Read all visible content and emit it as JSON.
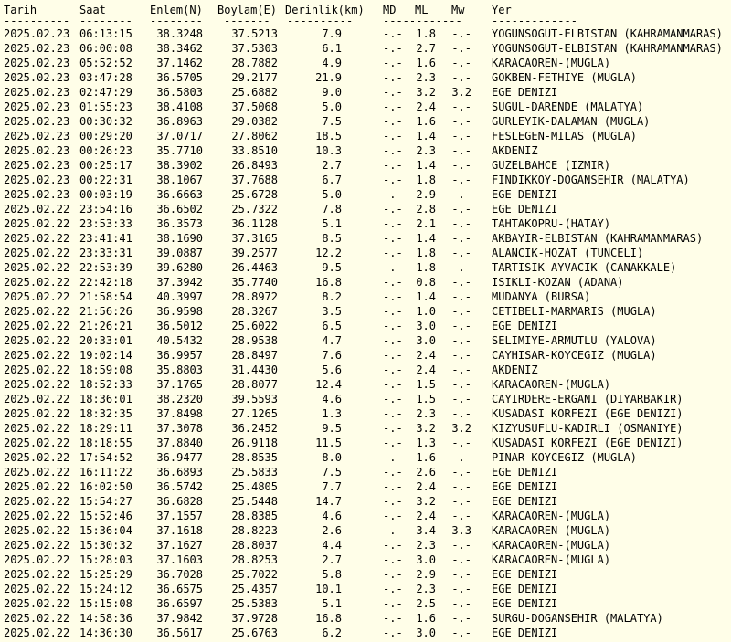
{
  "headers": {
    "date": "Tarih",
    "time": "Saat",
    "lat": "Enlem(N)",
    "lon": "Boylam(E)",
    "depth": "Derinlik(km)",
    "md": "MD",
    "ml": "ML",
    "mw": "Mw",
    "loc": "Yer"
  },
  "separators": {
    "date": "----------",
    "time": "--------",
    "lat": "--------",
    "lon": "-------",
    "depth": "----------",
    "md": "------------",
    "loc": "-------------"
  },
  "rows": [
    {
      "date": "2025.02.23",
      "time": "06:13:15",
      "lat": "38.3248",
      "lon": "37.5213",
      "depth": "7.9",
      "md": "-.-",
      "ml": "1.8",
      "mw": "-.-",
      "loc": "YOGUNSOGUT-ELBISTAN (KAHRAMANMARAS)"
    },
    {
      "date": "2025.02.23",
      "time": "06:00:08",
      "lat": "38.3462",
      "lon": "37.5303",
      "depth": "6.1",
      "md": "-.-",
      "ml": "2.7",
      "mw": "-.-",
      "loc": "YOGUNSOGUT-ELBISTAN (KAHRAMANMARAS)"
    },
    {
      "date": "2025.02.23",
      "time": "05:52:52",
      "lat": "37.1462",
      "lon": "28.7882",
      "depth": "4.9",
      "md": "-.-",
      "ml": "1.6",
      "mw": "-.-",
      "loc": "KARACAOREN-(MUGLA)"
    },
    {
      "date": "2025.02.23",
      "time": "03:47:28",
      "lat": "36.5705",
      "lon": "29.2177",
      "depth": "21.9",
      "md": "-.-",
      "ml": "2.3",
      "mw": "-.-",
      "loc": "GOKBEN-FETHIYE (MUGLA)"
    },
    {
      "date": "2025.02.23",
      "time": "02:47:29",
      "lat": "36.5803",
      "lon": "25.6882",
      "depth": "9.0",
      "md": "-.-",
      "ml": "3.2",
      "mw": "3.2",
      "loc": "EGE DENIZI"
    },
    {
      "date": "2025.02.23",
      "time": "01:55:23",
      "lat": "38.4108",
      "lon": "37.5068",
      "depth": "5.0",
      "md": "-.-",
      "ml": "2.4",
      "mw": "-.-",
      "loc": "SUGUL-DARENDE (MALATYA)"
    },
    {
      "date": "2025.02.23",
      "time": "00:30:32",
      "lat": "36.8963",
      "lon": "29.0382",
      "depth": "7.5",
      "md": "-.-",
      "ml": "1.6",
      "mw": "-.-",
      "loc": "GURLEYIK-DALAMAN (MUGLA)"
    },
    {
      "date": "2025.02.23",
      "time": "00:29:20",
      "lat": "37.0717",
      "lon": "27.8062",
      "depth": "18.5",
      "md": "-.-",
      "ml": "1.4",
      "mw": "-.-",
      "loc": "FESLEGEN-MILAS (MUGLA)"
    },
    {
      "date": "2025.02.23",
      "time": "00:26:23",
      "lat": "35.7710",
      "lon": "33.8510",
      "depth": "10.3",
      "md": "-.-",
      "ml": "2.3",
      "mw": "-.-",
      "loc": "AKDENIZ"
    },
    {
      "date": "2025.02.23",
      "time": "00:25:17",
      "lat": "38.3902",
      "lon": "26.8493",
      "depth": "2.7",
      "md": "-.-",
      "ml": "1.4",
      "mw": "-.-",
      "loc": "GUZELBAHCE (IZMIR)"
    },
    {
      "date": "2025.02.23",
      "time": "00:22:31",
      "lat": "38.1067",
      "lon": "37.7688",
      "depth": "6.7",
      "md": "-.-",
      "ml": "1.8",
      "mw": "-.-",
      "loc": "FINDIKKOY-DOGANSEHIR (MALATYA)"
    },
    {
      "date": "2025.02.23",
      "time": "00:03:19",
      "lat": "36.6663",
      "lon": "25.6728",
      "depth": "5.0",
      "md": "-.-",
      "ml": "2.9",
      "mw": "-.-",
      "loc": "EGE DENIZI"
    },
    {
      "date": "2025.02.22",
      "time": "23:54:16",
      "lat": "36.6502",
      "lon": "25.7322",
      "depth": "7.8",
      "md": "-.-",
      "ml": "2.8",
      "mw": "-.-",
      "loc": "EGE DENIZI"
    },
    {
      "date": "2025.02.22",
      "time": "23:53:33",
      "lat": "36.3573",
      "lon": "36.1128",
      "depth": "5.1",
      "md": "-.-",
      "ml": "2.1",
      "mw": "-.-",
      "loc": "TAHTAKOPRU-(HATAY)"
    },
    {
      "date": "2025.02.22",
      "time": "23:41:41",
      "lat": "38.1690",
      "lon": "37.3165",
      "depth": "8.5",
      "md": "-.-",
      "ml": "1.4",
      "mw": "-.-",
      "loc": "AKBAYIR-ELBISTAN (KAHRAMANMARAS)"
    },
    {
      "date": "2025.02.22",
      "time": "23:33:31",
      "lat": "39.0887",
      "lon": "39.2577",
      "depth": "12.2",
      "md": "-.-",
      "ml": "1.8",
      "mw": "-.-",
      "loc": "ALANCIK-HOZAT (TUNCELI)"
    },
    {
      "date": "2025.02.22",
      "time": "22:53:39",
      "lat": "39.6280",
      "lon": "26.4463",
      "depth": "9.5",
      "md": "-.-",
      "ml": "1.8",
      "mw": "-.-",
      "loc": "TARTISIK-AYVACIK (CANAKKALE)"
    },
    {
      "date": "2025.02.22",
      "time": "22:42:18",
      "lat": "37.3942",
      "lon": "35.7740",
      "depth": "16.8",
      "md": "-.-",
      "ml": "0.8",
      "mw": "-.-",
      "loc": "ISIKLI-KOZAN (ADANA)"
    },
    {
      "date": "2025.02.22",
      "time": "21:58:54",
      "lat": "40.3997",
      "lon": "28.8972",
      "depth": "8.2",
      "md": "-.-",
      "ml": "1.4",
      "mw": "-.-",
      "loc": "MUDANYA (BURSA)"
    },
    {
      "date": "2025.02.22",
      "time": "21:56:26",
      "lat": "36.9598",
      "lon": "28.3267",
      "depth": "3.5",
      "md": "-.-",
      "ml": "1.0",
      "mw": "-.-",
      "loc": "CETIBELI-MARMARIS (MUGLA)"
    },
    {
      "date": "2025.02.22",
      "time": "21:26:21",
      "lat": "36.5012",
      "lon": "25.6022",
      "depth": "6.5",
      "md": "-.-",
      "ml": "3.0",
      "mw": "-.-",
      "loc": "EGE DENIZI"
    },
    {
      "date": "2025.02.22",
      "time": "20:33:01",
      "lat": "40.5432",
      "lon": "28.9538",
      "depth": "4.7",
      "md": "-.-",
      "ml": "3.0",
      "mw": "-.-",
      "loc": "SELIMIYE-ARMUTLU (YALOVA)"
    },
    {
      "date": "2025.02.22",
      "time": "19:02:14",
      "lat": "36.9957",
      "lon": "28.8497",
      "depth": "7.6",
      "md": "-.-",
      "ml": "2.4",
      "mw": "-.-",
      "loc": "CAYHISAR-KOYCEGIZ (MUGLA)"
    },
    {
      "date": "2025.02.22",
      "time": "18:59:08",
      "lat": "35.8803",
      "lon": "31.4430",
      "depth": "5.6",
      "md": "-.-",
      "ml": "2.4",
      "mw": "-.-",
      "loc": "AKDENIZ"
    },
    {
      "date": "2025.02.22",
      "time": "18:52:33",
      "lat": "37.1765",
      "lon": "28.8077",
      "depth": "12.4",
      "md": "-.-",
      "ml": "1.5",
      "mw": "-.-",
      "loc": "KARACAOREN-(MUGLA)"
    },
    {
      "date": "2025.02.22",
      "time": "18:36:01",
      "lat": "38.2320",
      "lon": "39.5593",
      "depth": "4.6",
      "md": "-.-",
      "ml": "1.5",
      "mw": "-.-",
      "loc": "CAYIRDERE-ERGANI (DIYARBAKIR)"
    },
    {
      "date": "2025.02.22",
      "time": "18:32:35",
      "lat": "37.8498",
      "lon": "27.1265",
      "depth": "1.3",
      "md": "-.-",
      "ml": "2.3",
      "mw": "-.-",
      "loc": "KUSADASI KORFEZI (EGE DENIZI)"
    },
    {
      "date": "2025.02.22",
      "time": "18:29:11",
      "lat": "37.3078",
      "lon": "36.2452",
      "depth": "9.5",
      "md": "-.-",
      "ml": "3.2",
      "mw": "3.2",
      "loc": "KIZYUSUFLU-KADIRLI (OSMANIYE)"
    },
    {
      "date": "2025.02.22",
      "time": "18:18:55",
      "lat": "37.8840",
      "lon": "26.9118",
      "depth": "11.5",
      "md": "-.-",
      "ml": "1.3",
      "mw": "-.-",
      "loc": "KUSADASI KORFEZI (EGE DENIZI)"
    },
    {
      "date": "2025.02.22",
      "time": "17:54:52",
      "lat": "36.9477",
      "lon": "28.8535",
      "depth": "8.0",
      "md": "-.-",
      "ml": "1.6",
      "mw": "-.-",
      "loc": "PINAR-KOYCEGIZ (MUGLA)"
    },
    {
      "date": "2025.02.22",
      "time": "16:11:22",
      "lat": "36.6893",
      "lon": "25.5833",
      "depth": "7.5",
      "md": "-.-",
      "ml": "2.6",
      "mw": "-.-",
      "loc": "EGE DENIZI"
    },
    {
      "date": "2025.02.22",
      "time": "16:02:50",
      "lat": "36.5742",
      "lon": "25.4805",
      "depth": "7.7",
      "md": "-.-",
      "ml": "2.4",
      "mw": "-.-",
      "loc": "EGE DENIZI"
    },
    {
      "date": "2025.02.22",
      "time": "15:54:27",
      "lat": "36.6828",
      "lon": "25.5448",
      "depth": "14.7",
      "md": "-.-",
      "ml": "3.2",
      "mw": "-.-",
      "loc": "EGE DENIZI"
    },
    {
      "date": "2025.02.22",
      "time": "15:52:46",
      "lat": "37.1557",
      "lon": "28.8385",
      "depth": "4.6",
      "md": "-.-",
      "ml": "2.4",
      "mw": "-.-",
      "loc": "KARACAOREN-(MUGLA)"
    },
    {
      "date": "2025.02.22",
      "time": "15:36:04",
      "lat": "37.1618",
      "lon": "28.8223",
      "depth": "2.6",
      "md": "-.-",
      "ml": "3.4",
      "mw": "3.3",
      "loc": "KARACAOREN-(MUGLA)"
    },
    {
      "date": "2025.02.22",
      "time": "15:30:32",
      "lat": "37.1627",
      "lon": "28.8037",
      "depth": "4.4",
      "md": "-.-",
      "ml": "2.3",
      "mw": "-.-",
      "loc": "KARACAOREN-(MUGLA)"
    },
    {
      "date": "2025.02.22",
      "time": "15:28:03",
      "lat": "37.1603",
      "lon": "28.8253",
      "depth": "2.7",
      "md": "-.-",
      "ml": "3.0",
      "mw": "-.-",
      "loc": "KARACAOREN-(MUGLA)"
    },
    {
      "date": "2025.02.22",
      "time": "15:25:29",
      "lat": "36.7028",
      "lon": "25.7022",
      "depth": "5.8",
      "md": "-.-",
      "ml": "2.9",
      "mw": "-.-",
      "loc": "EGE DENIZI"
    },
    {
      "date": "2025.02.22",
      "time": "15:24:12",
      "lat": "36.6575",
      "lon": "25.4357",
      "depth": "10.1",
      "md": "-.-",
      "ml": "2.3",
      "mw": "-.-",
      "loc": "EGE DENIZI"
    },
    {
      "date": "2025.02.22",
      "time": "15:15:08",
      "lat": "36.6597",
      "lon": "25.5383",
      "depth": "5.1",
      "md": "-.-",
      "ml": "2.5",
      "mw": "-.-",
      "loc": "EGE DENIZI"
    },
    {
      "date": "2025.02.22",
      "time": "14:58:36",
      "lat": "37.9842",
      "lon": "37.9728",
      "depth": "16.8",
      "md": "-.-",
      "ml": "1.6",
      "mw": "-.-",
      "loc": "SURGU-DOGANSEHIR (MALATYA)"
    },
    {
      "date": "2025.02.22",
      "time": "14:36:30",
      "lat": "36.5617",
      "lon": "25.6763",
      "depth": "6.2",
      "md": "-.-",
      "ml": "3.0",
      "mw": "-.-",
      "loc": "EGE DENIZI"
    }
  ]
}
